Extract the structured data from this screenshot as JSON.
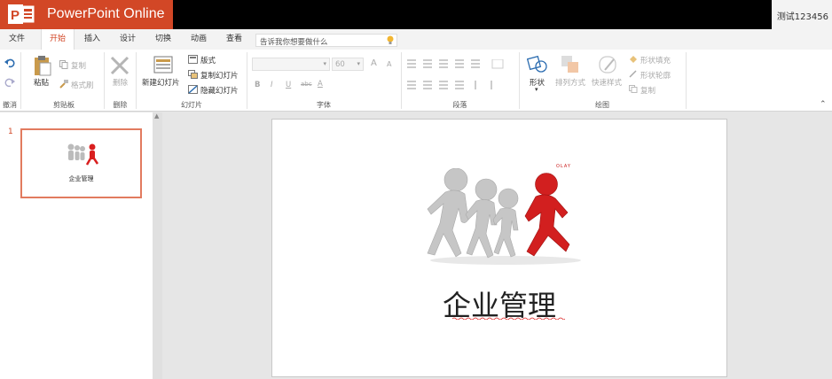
{
  "app": {
    "name": "PowerPoint Online",
    "user": "测试123456",
    "brand_color": "#d24726"
  },
  "tabs": [
    {
      "label": "文件"
    },
    {
      "label": "开始",
      "active": true
    },
    {
      "label": "插入"
    },
    {
      "label": "设计"
    },
    {
      "label": "切换"
    },
    {
      "label": "动画"
    },
    {
      "label": "查看"
    }
  ],
  "tell_me": {
    "placeholder": "告诉我你想要做什么",
    "icon": "lightbulb-icon"
  },
  "ribbon": {
    "undo": {
      "label": "撤消",
      "icons": [
        "undo-icon",
        "redo-icon"
      ]
    },
    "clipboard": {
      "paste": "粘贴",
      "copy": "复制",
      "format_painter": "格式刷",
      "label": "剪贴板"
    },
    "delete": {
      "button": "删除",
      "label": "删除"
    },
    "slides": {
      "new_slide": "新建幻灯片",
      "layout": "版式",
      "duplicate": "复制幻灯片",
      "hide": "隐藏幻灯片",
      "label": "幻灯片"
    },
    "font": {
      "size": "60",
      "bold": "B",
      "italic": "I",
      "underline": "U",
      "strike": "abc",
      "color": "A",
      "grow": "A",
      "shrink": "A",
      "label": "字体"
    },
    "paragraph": {
      "label": "段落"
    },
    "drawing": {
      "shapes": "形状",
      "arrange": "排列方式",
      "quick_styles": "快速样式",
      "shape_fill": "形状填充",
      "shape_outline": "形状轮廓",
      "duplicate": "复制",
      "label": "绘图"
    }
  },
  "thumbnails": [
    {
      "number": "1",
      "title": "企业管理"
    }
  ],
  "slide": {
    "title": "企业管理",
    "image_caption": "OLAY"
  }
}
